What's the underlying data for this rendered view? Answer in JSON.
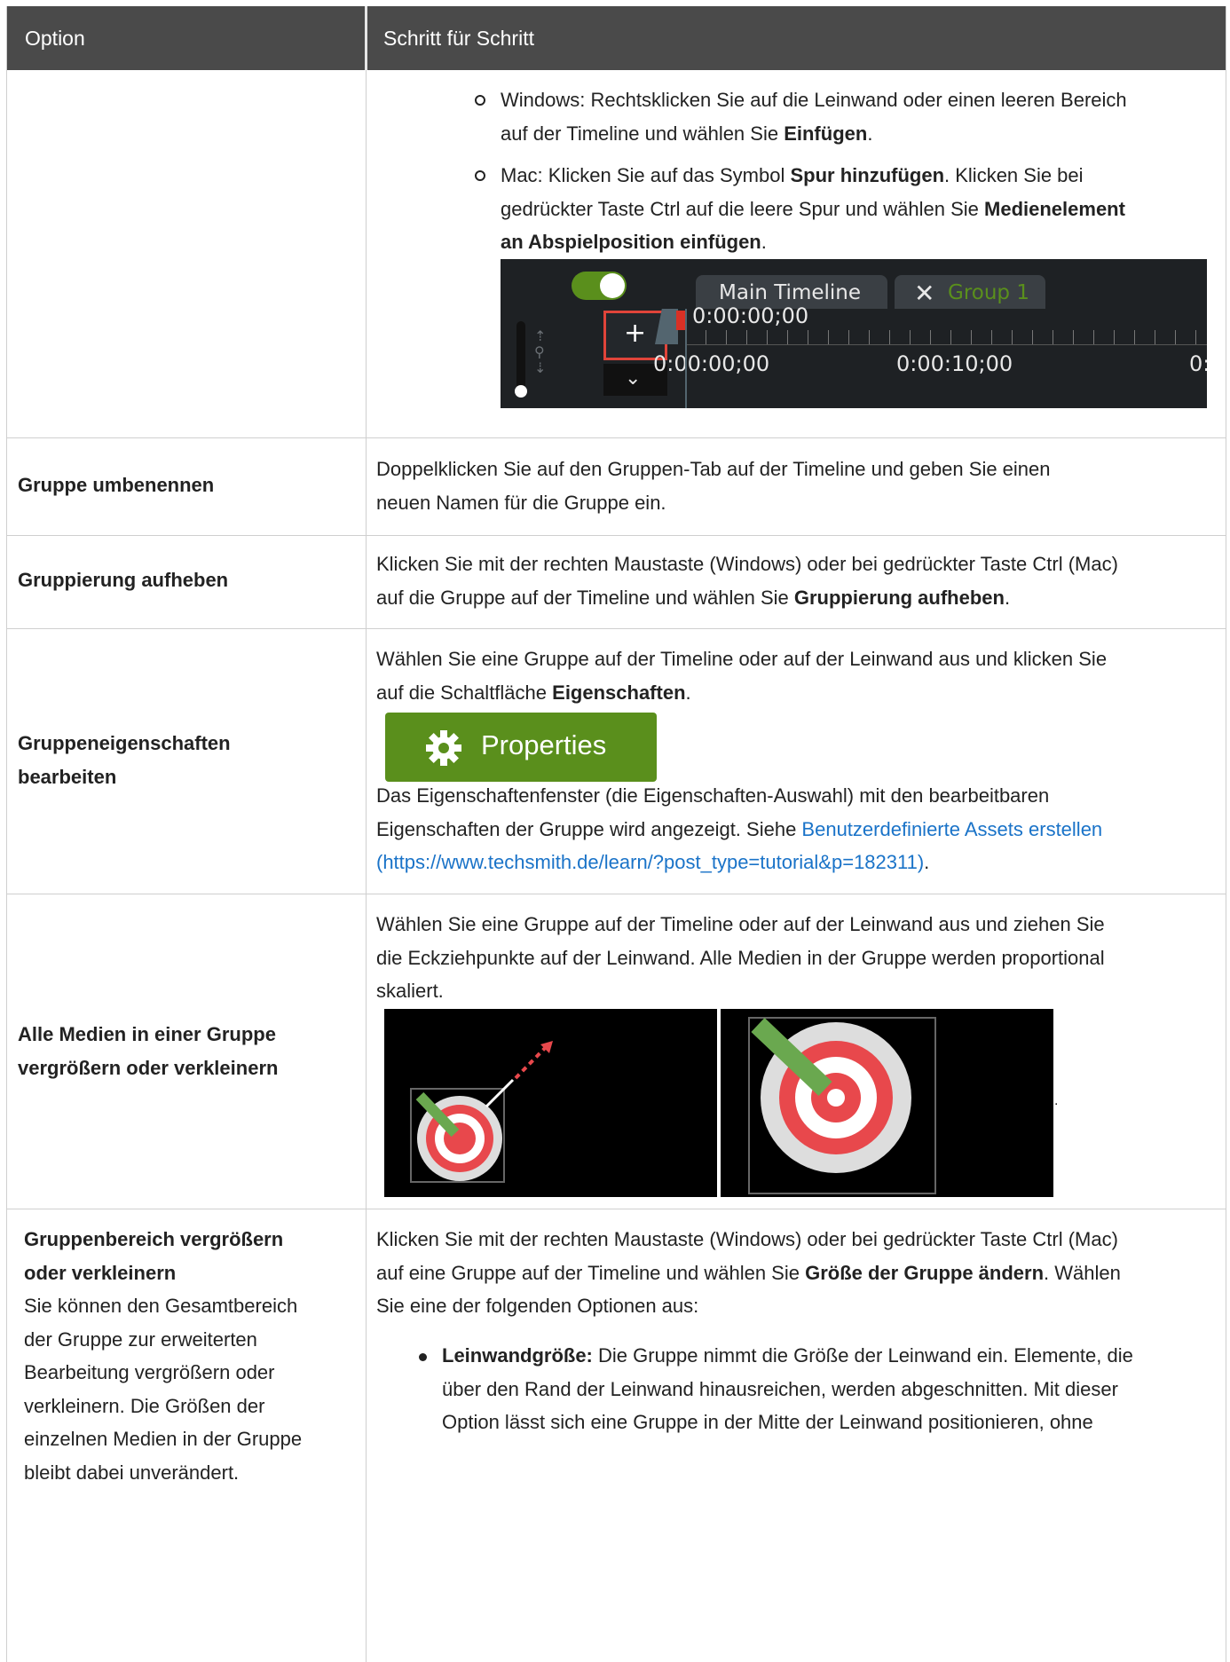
{
  "header": {
    "col1": "Option",
    "col2": "Schritt für Schritt"
  },
  "row0": {
    "win_pre": "Windows: Rechtsklicken Sie auf die Leinwand oder einen leeren Bereich",
    "win_line2_pre": "auf der Timeline und wählen Sie ",
    "win_bold": "Einfügen",
    "win_post": ".",
    "mac_pre": "Mac: Klicken Sie auf das Symbol ",
    "mac_bold1": "Spur hinzufügen",
    "mac_mid": ". Klicken Sie bei",
    "mac_line2_pre": "gedrückter Taste Ctrl auf die leere Spur und wählen Sie ",
    "mac_bold2a": "Medienelement",
    "mac_bold2b": "an Abspielposition einfügen",
    "mac_post": ".",
    "timeline": {
      "tab_main": "Main Timeline",
      "tab_group": "Group 1",
      "playhead": "0:00:00;00",
      "tick0": "0:00:00;00",
      "tick1": "0:00:10;00",
      "tick2": "0:"
    }
  },
  "row1": {
    "label": "Gruppe umbenennen",
    "l1": "Doppelklicken Sie auf den Gruppen-Tab auf der Timeline und geben Sie einen",
    "l2": "neuen Namen für die Gruppe ein."
  },
  "row2": {
    "label": "Gruppierung aufheben",
    "l1": "Klicken Sie mit der rechten Maustaste (Windows) oder bei gedrückter Taste Ctrl (Mac)",
    "l2_pre": "auf die Gruppe auf der Timeline und wählen Sie ",
    "l2_bold": "Gruppierung aufheben",
    "l2_post": "."
  },
  "row3": {
    "label1": "Gruppeneigenschaften",
    "label2": "bearbeiten",
    "l1": "Wählen Sie eine Gruppe auf der Timeline oder auf der Leinwand aus und klicken Sie",
    "l2_pre": "auf die Schaltfläche ",
    "l2_bold": "Eigenschaften",
    "l2_post": ".",
    "button_label": "Properties",
    "l3": "Das Eigenschaftenfenster (die Eigenschaften-Auswahl) mit den bearbeitbaren",
    "l4_pre": "Eigenschaften der Gruppe wird angezeigt. Siehe ",
    "link1": "Benutzerdefinierte Assets erstellen",
    "link2": "(https://www.techsmith.de/learn/?post_type=tutorial&p=182311)",
    "l5_post": "."
  },
  "row4": {
    "label1": "Alle Medien in einer Gruppe",
    "label2": "vergrößern oder verkleinern",
    "l1": "Wählen Sie eine Gruppe auf der Timeline oder auf der Leinwand aus und ziehen Sie",
    "l2": "die Eckziehpunkte auf der Leinwand. Alle Medien in der Gruppe werden proportional",
    "l3": "skaliert.",
    "trail": "."
  },
  "row5": {
    "label1": "Gruppenbereich vergrößern",
    "label2": "oder verkleinern",
    "desc": [
      "Sie können den Gesamtbereich",
      "der Gruppe zur erweiterten",
      "Bearbeitung vergrößern oder",
      "verkleinern. Die Größen der",
      "einzelnen Medien in der Gruppe",
      "bleibt dabei unverändert."
    ],
    "l1": "Klicken Sie mit der rechten Maustaste (Windows) oder bei gedrückter Taste Ctrl (Mac)",
    "l2_pre": "auf eine Gruppe auf der Timeline und wählen Sie ",
    "l2_bold": "Größe der Gruppe ändern",
    "l2_post": ". Wählen",
    "l3": "Sie eine der folgenden Optionen aus:",
    "b_bold": "Leinwandgröße:",
    "b1": " Die Gruppe nimmt die Größe der Leinwand ein. Elemente, die",
    "b2": "über den Rand der Leinwand hinausreichen, werden abgeschnitten. Mit dieser",
    "b3": "Option lässt sich eine Gruppe in der Mitte der Leinwand positionieren, ohne"
  }
}
